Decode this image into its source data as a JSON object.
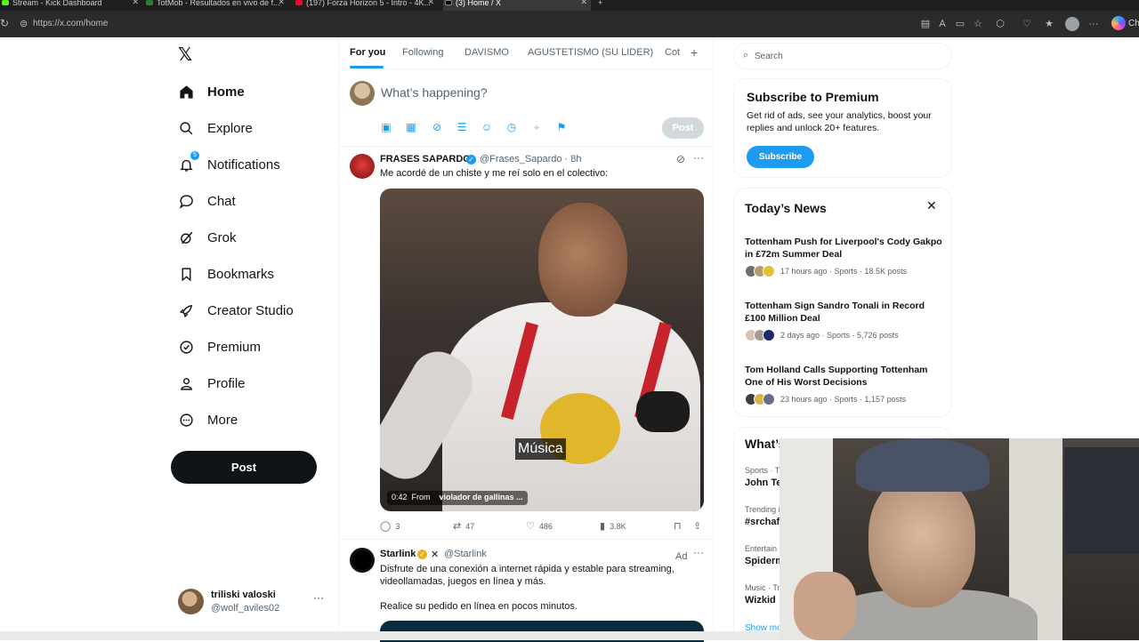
{
  "browser": {
    "tabs": [
      {
        "title": "Stream - Kick Dashboard",
        "active": false
      },
      {
        "title": "TotMob - Resultados en vivo de f...",
        "active": false
      },
      {
        "title": "(197) Forza Horizon 5 - Intro - 4K...",
        "active": false
      },
      {
        "title": "(3) Home / X",
        "active": true
      }
    ],
    "url": "https://x.com/home",
    "chat_label": "Cha"
  },
  "nav": {
    "items": [
      {
        "label": "Home",
        "icon": "home-icon",
        "active": true
      },
      {
        "label": "Explore",
        "icon": "search-icon"
      },
      {
        "label": "Notifications",
        "icon": "bell-icon",
        "badge": "5"
      },
      {
        "label": "Chat",
        "icon": "chat-bubble-icon"
      },
      {
        "label": "Grok",
        "icon": "grok-icon"
      },
      {
        "label": "Bookmarks",
        "icon": "bookmark-icon"
      },
      {
        "label": "Creator Studio",
        "icon": "rocket-icon"
      },
      {
        "label": "Premium",
        "icon": "verified-badge-icon"
      },
      {
        "label": "Profile",
        "icon": "person-icon"
      },
      {
        "label": "More",
        "icon": "more-circle-icon"
      }
    ],
    "post_label": "Post",
    "account": {
      "name": "triliski valoski",
      "handle": "@wolf_aviles02"
    }
  },
  "feed": {
    "tabs": [
      "For you",
      "Following",
      "DAVISMO",
      "AGUSTETISMO (SU LIDER)",
      "Cot"
    ],
    "composer_placeholder": "What’s happening?",
    "composer_post": "Post",
    "tweets": [
      {
        "name": "FRASES SAPARDO",
        "handle": "@Frases_Sapardo · 8h",
        "text": "Me acordé de un chiste y me reí solo en el colectivo:",
        "video": {
          "caption": "Música",
          "duration": "0:42",
          "from_label": "From",
          "from": "violador de gallinas ..."
        },
        "actions": {
          "replies": "3",
          "reposts": "47",
          "likes": "486",
          "views": "3.8K"
        }
      },
      {
        "name": "Starlink",
        "handle": "@Starlink",
        "ad_label": "Ad",
        "text": "Disfrute de una conexión a internet rápida y estable para streaming, videollamadas, juegos en línea y más.",
        "text2": "Realice su pedido en línea en pocos minutos."
      }
    ]
  },
  "sidebar": {
    "search_placeholder": "Search",
    "premium": {
      "title": "Subscribe to Premium",
      "text": "Get rid of ads, see your analytics, boost your replies and unlock 20+ features.",
      "button": "Subscribe"
    },
    "news": {
      "title": "Today’s News",
      "items": [
        {
          "title": "Tottenham Push for Liverpool's Cody Gakpo in £72m Summer Deal",
          "meta": "17 hours ago · Sports · 18.5K posts"
        },
        {
          "title": "Tottenham Sign Sandro Tonali in Record £100 Million Deal",
          "meta": "2 days ago · Sports · 5,726 posts"
        },
        {
          "title": "Tom Holland Calls Supporting Tottenham One of His Worst Decisions",
          "meta": "23 hours ago · Sports · 1,157 posts"
        }
      ]
    },
    "happening": {
      "title": "What’s happening",
      "items": [
        {
          "category": "Sports · T",
          "name": "John Ter"
        },
        {
          "category": "Trending i",
          "name": "#srchaf"
        },
        {
          "category": "Entertain",
          "name": "Spiderm"
        },
        {
          "category": "Music · Tr",
          "name": "Wizkid"
        }
      ],
      "show_more": "Show more"
    }
  },
  "colors": {
    "accent": "#1d9bf0",
    "text": "#0f1419",
    "muted": "#536471"
  }
}
